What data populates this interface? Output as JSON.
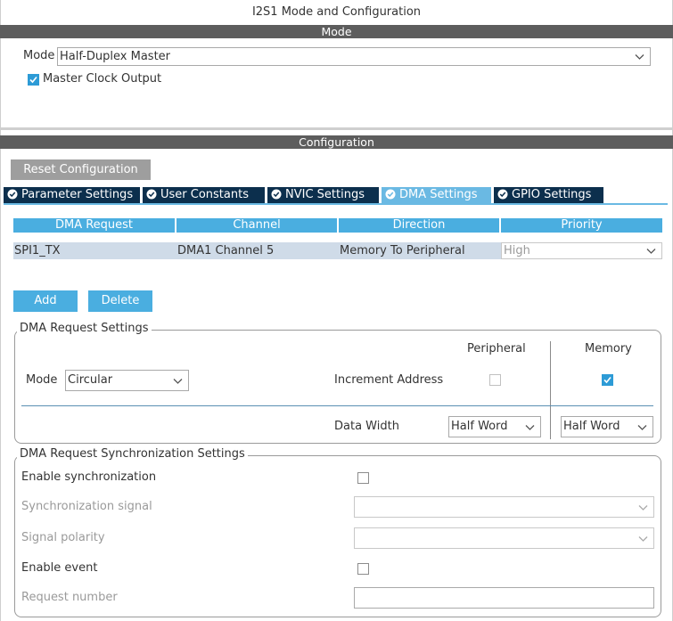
{
  "window": {
    "title": "I2S1 Mode and Configuration"
  },
  "mode_section": {
    "header": "Mode",
    "mode_label": "Mode",
    "mode_value": "Half-Duplex Master",
    "master_clock_label": "Master Clock Output",
    "master_clock_checked": true
  },
  "config_section": {
    "header": "Configuration",
    "reset_label": "Reset Configuration",
    "tabs": [
      {
        "label": "Parameter Settings",
        "active": false
      },
      {
        "label": "User Constants",
        "active": false
      },
      {
        "label": "NVIC Settings",
        "active": false
      },
      {
        "label": "DMA Settings",
        "active": true
      },
      {
        "label": "GPIO Settings",
        "active": false
      }
    ]
  },
  "dma_table": {
    "headers": [
      "DMA Request",
      "Channel",
      "Direction",
      "Priority"
    ],
    "rows": [
      {
        "request": "SPI1_TX",
        "channel": "DMA1 Channel 5",
        "direction": "Memory To Peripheral",
        "priority": "High"
      }
    ]
  },
  "buttons": {
    "add": "Add",
    "delete": "Delete"
  },
  "dma_request_settings": {
    "title": "DMA Request Settings",
    "peripheral_label": "Peripheral",
    "memory_label": "Memory",
    "mode_label": "Mode",
    "mode_value": "Circular",
    "increment_label": "Increment Address",
    "peripheral_increment": false,
    "memory_increment": true,
    "data_width_label": "Data Width",
    "peripheral_width": "Half Word",
    "memory_width": "Half Word"
  },
  "sync_settings": {
    "title": "DMA Request Synchronization Settings",
    "enable_sync_label": "Enable synchronization",
    "sync_signal_label": "Synchronization signal",
    "signal_polarity_label": "Signal polarity",
    "enable_event_label": "Enable event",
    "request_number_label": "Request number"
  },
  "colors": {
    "header_bar": "#5d5d5d",
    "tab_dark": "#0c2f4d",
    "tab_active": "#6ab9e3",
    "table_header": "#4aaee0",
    "row_selected": "#cfdbe8",
    "checkbox_on": "#2d9bd6"
  }
}
